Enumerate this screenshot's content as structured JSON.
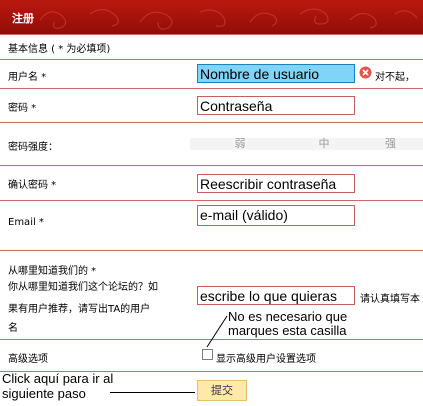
{
  "header": {
    "title": "注册"
  },
  "basic_info": "基本信息 ( * 为必填项)",
  "username": {
    "label": "用户名 *",
    "value": "Nombre de usuario",
    "error": "对不起，"
  },
  "password": {
    "label": "密码 *",
    "value": "Contraseña"
  },
  "strength": {
    "label": "密码强度：",
    "levels": [
      "弱",
      "中",
      "强"
    ]
  },
  "confirm": {
    "label": "确认密码 *",
    "value": "Reescribir contraseña"
  },
  "email": {
    "label": "Email *",
    "value": "e-mail (válido)"
  },
  "source": {
    "label1": "从哪里知道我们的 *",
    "label2": "你从哪里知道我们这个论坛的？如",
    "label3": "果有用户推荐，请写出TA的用户",
    "label4": "名",
    "value": "escribe lo que quieras",
    "hint": "请认真填写本"
  },
  "annotation1": {
    "line1": "No es necesario que",
    "line2": "marques esta casilla"
  },
  "advanced": {
    "label": "高级选项",
    "checkbox_label": "显示高级用户设置选项",
    "checked": false
  },
  "annotation2": {
    "line1": "Click aquí para ir al",
    "line2": "siguiente paso"
  },
  "submit_label": "提交",
  "colors": {
    "header": "#a4120b",
    "row_line": "#cc6b66",
    "highlight": "#7fd4f7",
    "error": "#e0574f"
  }
}
